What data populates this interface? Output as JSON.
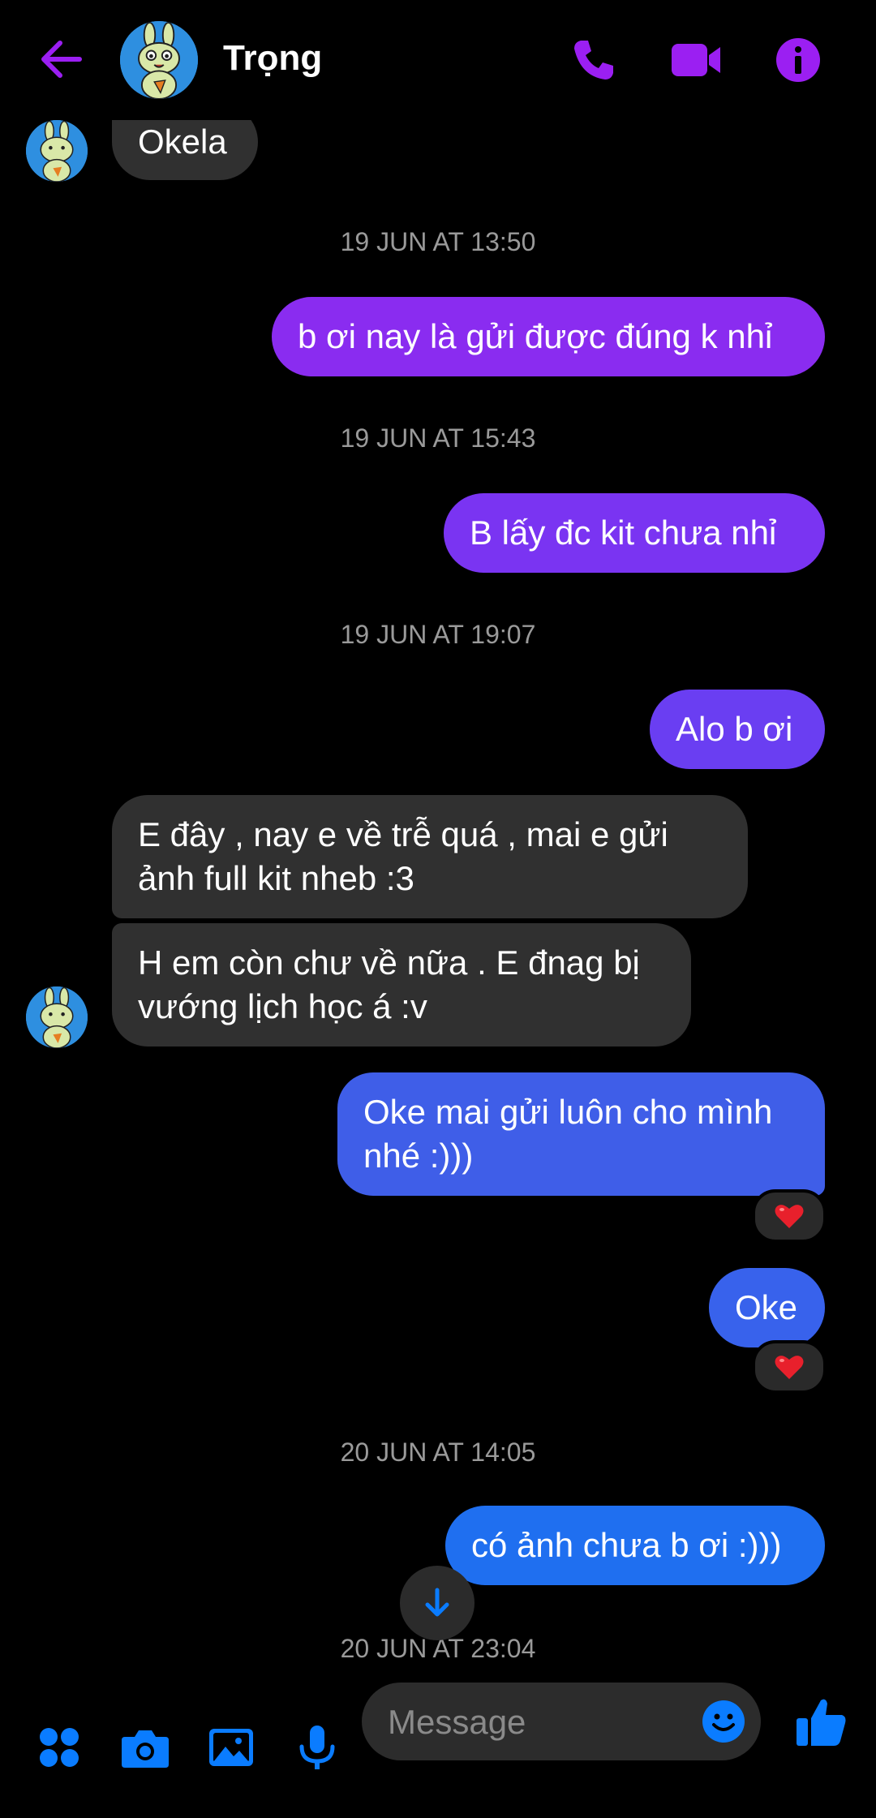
{
  "header": {
    "contact_name": "Trọng"
  },
  "messages": [
    {
      "type": "incoming",
      "text": "Okela"
    },
    {
      "type": "timestamp",
      "text": "19 JUN AT 13:50"
    },
    {
      "type": "outgoing",
      "text": "b ơi nay là gửi được đúng k nhỉ"
    },
    {
      "type": "timestamp",
      "text": "19 JUN AT 15:43"
    },
    {
      "type": "outgoing",
      "text": "B lấy đc kit chưa nhỉ"
    },
    {
      "type": "timestamp",
      "text": "19 JUN AT 19:07"
    },
    {
      "type": "outgoing",
      "text": "Alo b ơi"
    },
    {
      "type": "incoming",
      "lines": [
        "E đây , nay e về trễ quá , mai e gửi",
        "ảnh full kit nheb :3"
      ]
    },
    {
      "type": "incoming",
      "lines": [
        "H em còn chư về nữa . E đnag bị",
        "vướng lịch học á :v"
      ]
    },
    {
      "type": "outgoing",
      "lines": [
        "Oke mai gửi luôn cho mình",
        "nhé :)))"
      ],
      "reaction": "heart"
    },
    {
      "type": "outgoing",
      "text": "Oke",
      "reaction": "heart"
    },
    {
      "type": "timestamp",
      "text": "20 JUN AT 14:05"
    },
    {
      "type": "outgoing",
      "text": "có ảnh chưa b ơi :)))"
    },
    {
      "type": "timestamp",
      "text": "20 JUN AT 23:04"
    }
  ],
  "composer": {
    "placeholder": "Message"
  },
  "icons": {
    "back": "arrow-left-icon",
    "call": "phone-icon",
    "video": "video-camera-icon",
    "info": "info-icon",
    "menu": "four-dots-icon",
    "camera": "camera-icon",
    "gallery": "image-icon",
    "mic": "microphone-icon",
    "emoji": "smiley-icon",
    "like": "thumbs-up-icon",
    "scroll": "arrow-down-icon"
  },
  "colors": {
    "accent_header": "#9b1ff2",
    "accent_composer": "#0a7cff",
    "bubble_in": "#303030",
    "bubble_out_purple": "#8a2cf0",
    "bubble_out_indigo": "#6a3ef2",
    "bubble_out_blue": "#3f5ee8",
    "bubble_out_blue2": "#1f6ff0"
  }
}
